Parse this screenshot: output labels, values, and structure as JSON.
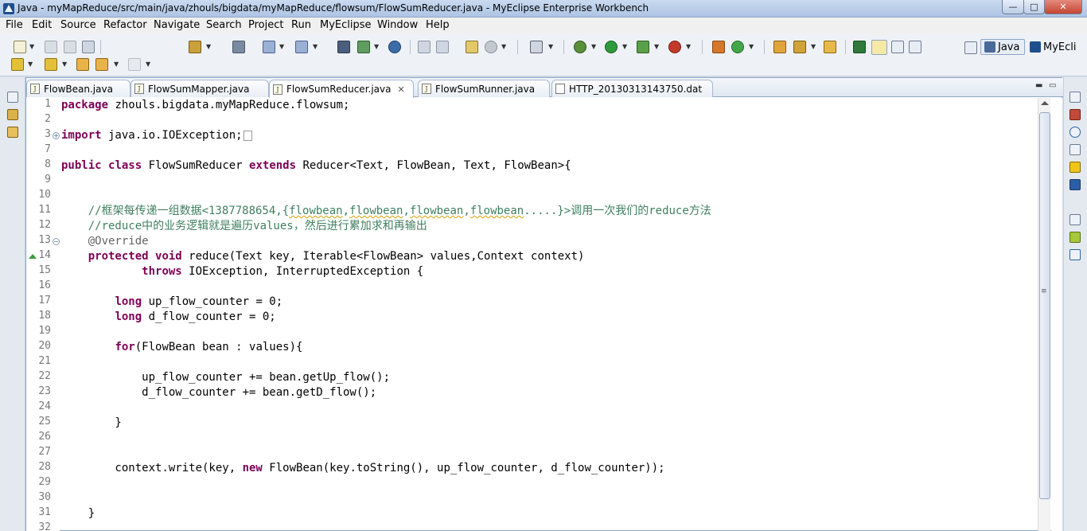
{
  "window": {
    "title": "Java - myMapReduce/src/main/java/zhouls/bigdata/myMapReduce/flowsum/FlowSumReducer.java - MyEclipse Enterprise Workbench",
    "min_label": "—",
    "max_label": "□",
    "close_label": "✕"
  },
  "menu": [
    "File",
    "Edit",
    "Source",
    "Refactor",
    "Navigate",
    "Search",
    "Project",
    "Run",
    "MyEclipse",
    "Window",
    "Help"
  ],
  "perspectives": {
    "java": "Java",
    "myeclipse": "MyEcli"
  },
  "tabs": [
    {
      "label": "FlowBean.java",
      "active": false
    },
    {
      "label": "FlowSumMapper.java",
      "active": false
    },
    {
      "label": "FlowSumReducer.java",
      "active": true
    },
    {
      "label": "FlowSumRunner.java",
      "active": false
    },
    {
      "label": "HTTP_20130313143750.dat",
      "active": false
    }
  ],
  "editor": {
    "line_numbers": [
      "1",
      "2",
      "3",
      "7",
      "8",
      "9",
      "10",
      "11",
      "12",
      "13",
      "14",
      "15",
      "16",
      "17",
      "18",
      "19",
      "20",
      "21",
      "22",
      "23",
      "24",
      "25",
      "26",
      "27",
      "28",
      "29",
      "30",
      "31",
      "32"
    ],
    "code": {
      "l1_kw": "package",
      "l1_rest": " zhouls.bigdata.myMapReduce.flowsum;",
      "l3_kw": "import",
      "l3_rest": " java.io.IOException;",
      "l8_kw1": "public",
      "l8_kw2": "class",
      "l8_name": " FlowSumReducer ",
      "l8_kw3": "extends",
      "l8_rest": " Reducer<Text, FlowBean, Text, FlowBean>{",
      "l11_a": "    //框架每传递一组数据<1387788654,{",
      "l11_b": "flowbean",
      "l11_c": ",",
      "l11_d": "flowbean",
      "l11_e": ",",
      "l11_f": "flowbean",
      "l11_g": ",",
      "l11_h": "flowbean",
      "l11_i": ".....}>调用一次我们的reduce方法",
      "l12": "    //reduce中的业务逻辑就是遍历values，然后进行累加求和再输出",
      "l13": "    @Override",
      "l14_kw1": "protected",
      "l14_kw2": "void",
      "l14_rest": " reduce(Text key, Iterable<FlowBean> values,Context context)",
      "l15_kw": "throws",
      "l15_rest": " IOException, InterruptedException {",
      "l17_kw": "long",
      "l17_rest": " up_flow_counter = 0;",
      "l18_kw": "long",
      "l18_rest": " d_flow_counter = 0;",
      "l20_kw": "for",
      "l20_rest": "(FlowBean bean : values){",
      "l22": "            up_flow_counter += bean.getUp_flow();",
      "l23": "            d_flow_counter += bean.getD_flow();",
      "l25": "        }",
      "l28_a": "        context.write(key, ",
      "l28_kw": "new",
      "l28_rest": " FlowBean(key.toString(), up_flow_counter, d_flow_counter));",
      "l31": "    }"
    }
  }
}
